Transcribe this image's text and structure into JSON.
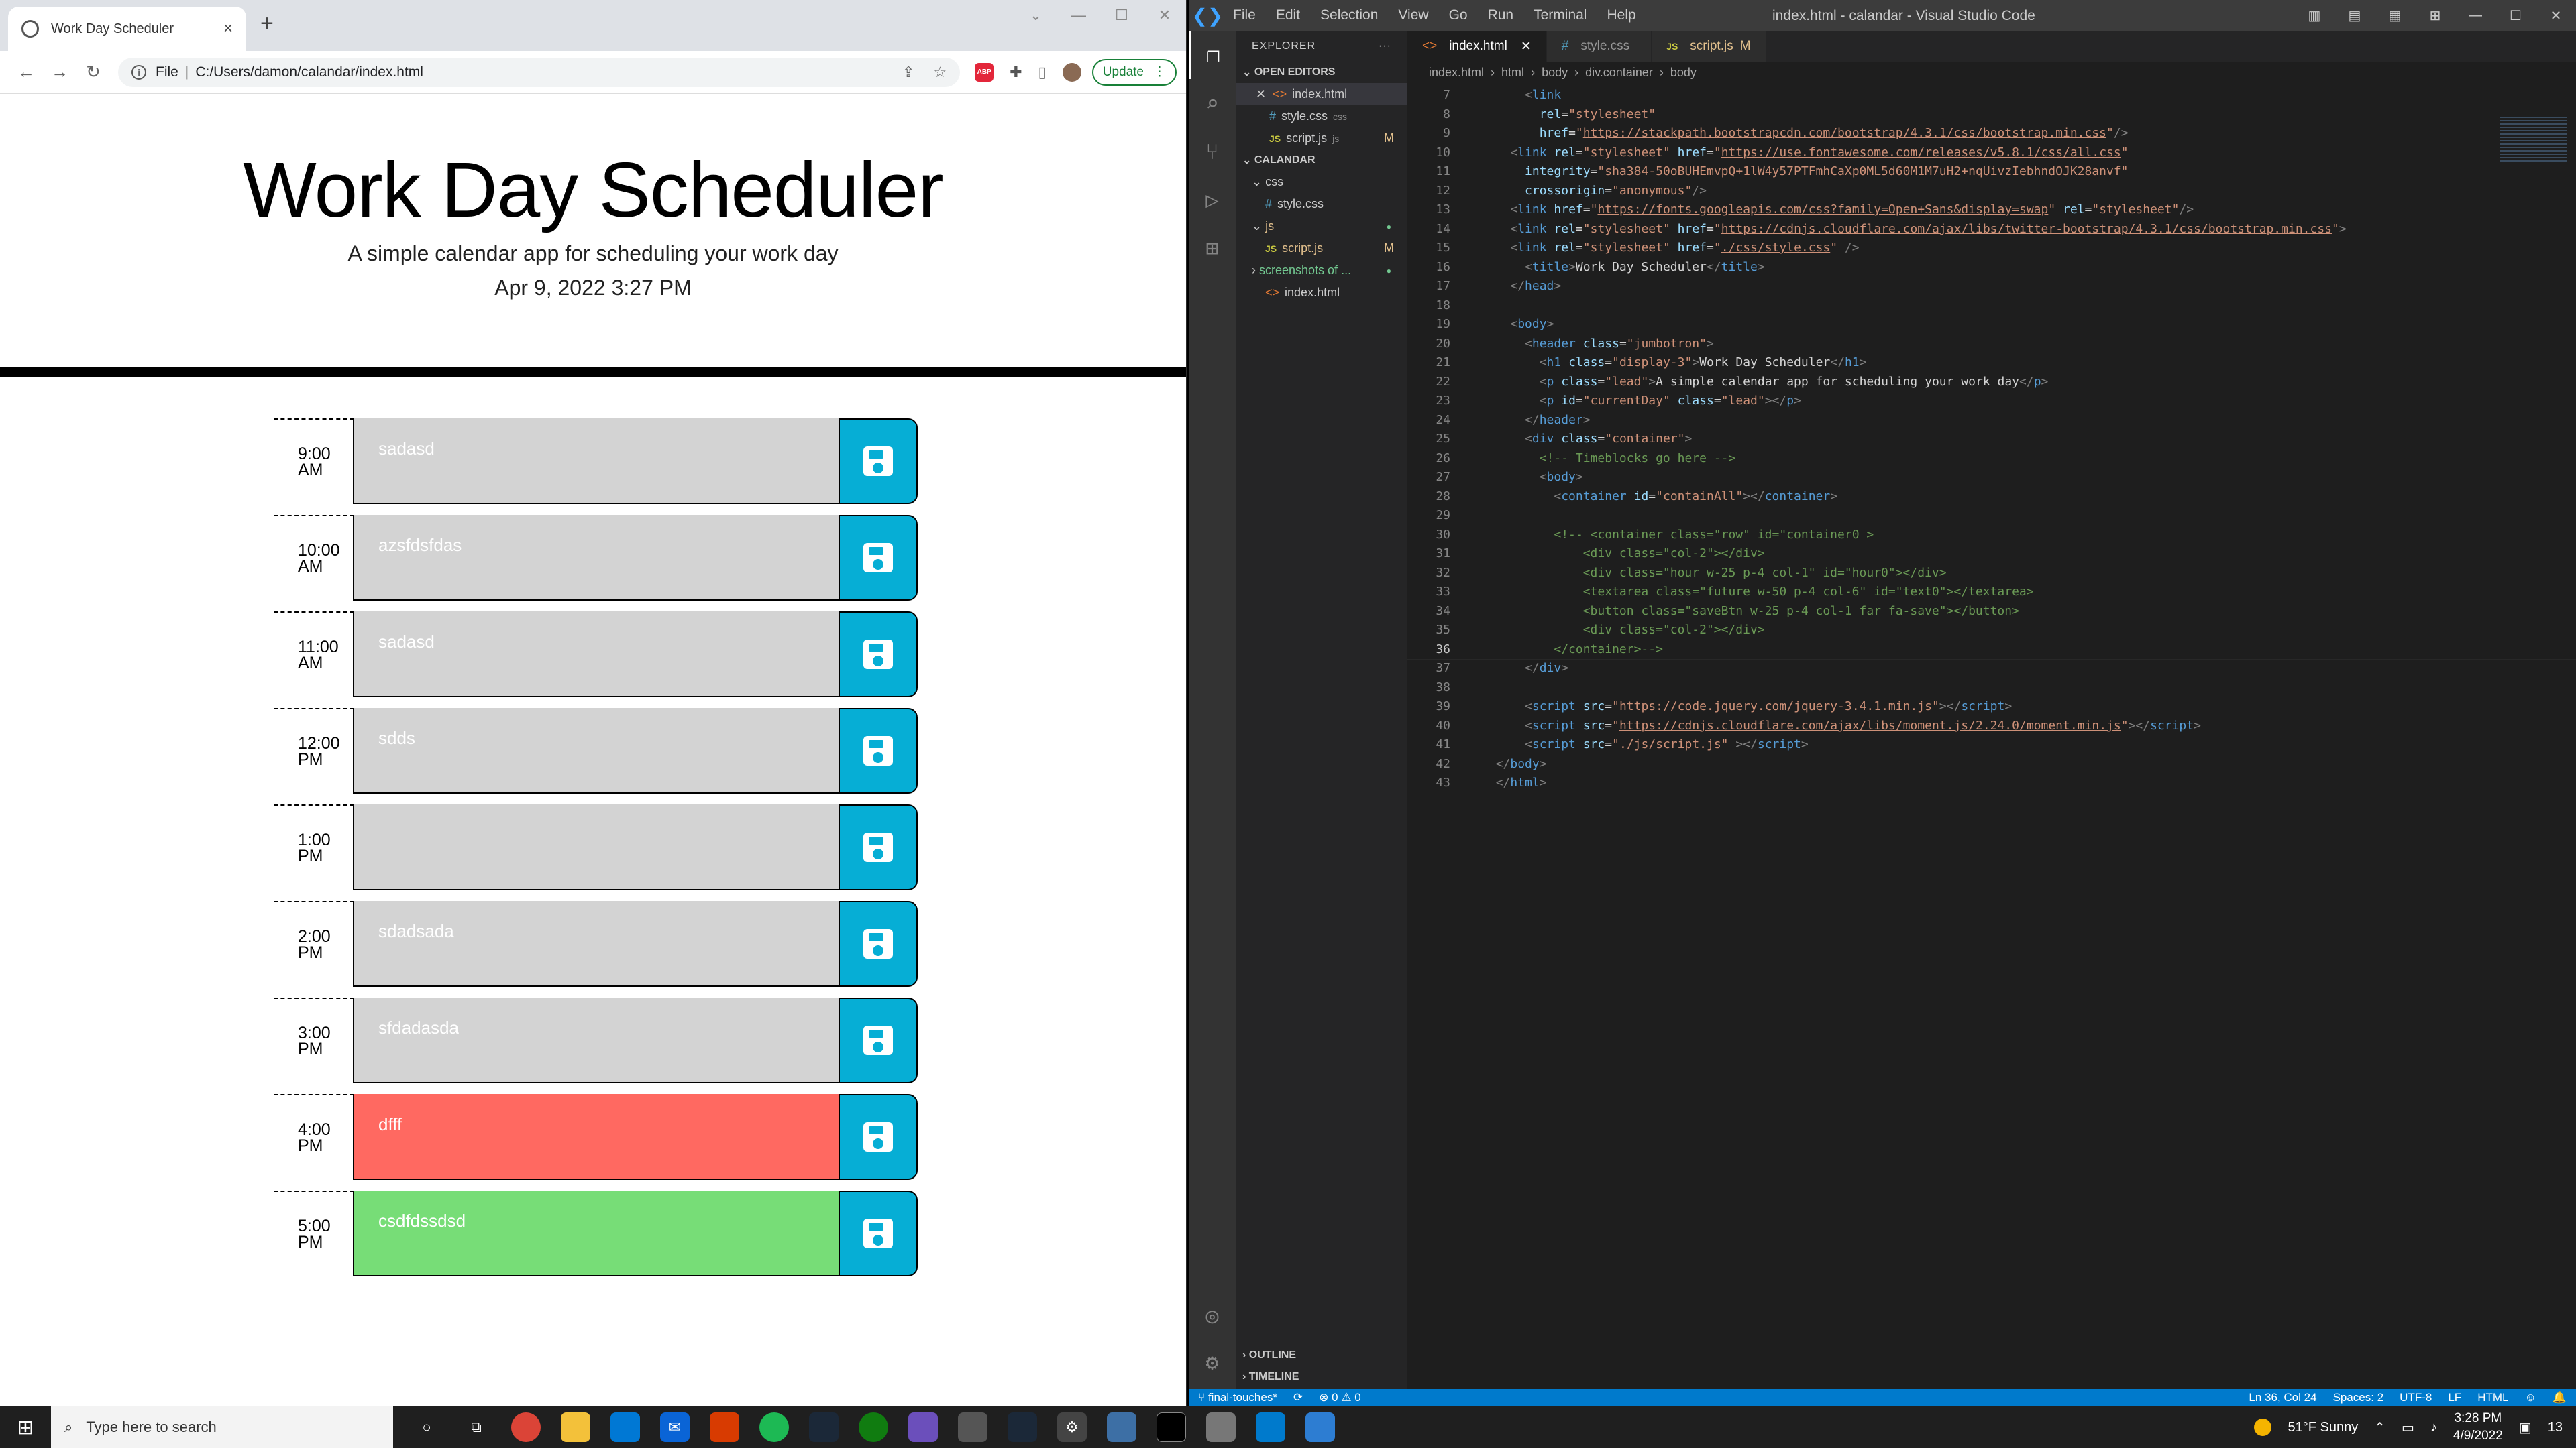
{
  "browser": {
    "tab_title": "Work Day Scheduler",
    "address_prefix": "File",
    "url": "C:/Users/damon/calandar/index.html",
    "update_label": "Update"
  },
  "scheduler": {
    "title": "Work Day Scheduler",
    "lead": "A simple calendar app for scheduling your work day",
    "current_day": "Apr 9, 2022 3:27 PM",
    "blocks": [
      {
        "hour": "9:00",
        "ampm": "AM",
        "text": "sadasd",
        "state": "past"
      },
      {
        "hour": "10:00",
        "ampm": "AM",
        "text": "azsfdsfdas",
        "state": "past"
      },
      {
        "hour": "11:00",
        "ampm": "AM",
        "text": "sadasd",
        "state": "past"
      },
      {
        "hour": "12:00",
        "ampm": "PM",
        "text": "sdds",
        "state": "past"
      },
      {
        "hour": "1:00",
        "ampm": "PM",
        "text": "",
        "state": "past"
      },
      {
        "hour": "2:00",
        "ampm": "PM",
        "text": "sdadsada",
        "state": "past"
      },
      {
        "hour": "3:00",
        "ampm": "PM",
        "text": "sfdadasda",
        "state": "past"
      },
      {
        "hour": "4:00",
        "ampm": "PM",
        "text": "dfff",
        "state": "present"
      },
      {
        "hour": "5:00",
        "ampm": "PM",
        "text": "csdfdssdsd",
        "state": "future"
      }
    ]
  },
  "vscode": {
    "window_title": "index.html - calandar - Visual Studio Code",
    "menu": [
      "File",
      "Edit",
      "Selection",
      "View",
      "Go",
      "Run",
      "Terminal",
      "Help"
    ],
    "explorer_title": "EXPLORER",
    "open_editors_label": "OPEN EDITORS",
    "open_editors": [
      {
        "name": "index.html",
        "hint": "",
        "badge": ""
      },
      {
        "name": "style.css",
        "hint": "css",
        "badge": ""
      },
      {
        "name": "script.js",
        "hint": "js",
        "badge": "M"
      }
    ],
    "project_label": "CALANDAR",
    "tree": [
      {
        "name": "css",
        "kind": "folder",
        "badge": ""
      },
      {
        "name": "style.css",
        "kind": "css",
        "badge": ""
      },
      {
        "name": "js",
        "kind": "folder",
        "badge": ""
      },
      {
        "name": "script.js",
        "kind": "js",
        "badge": "M"
      },
      {
        "name": "screenshots of ...",
        "kind": "folder",
        "badge": ""
      },
      {
        "name": "index.html",
        "kind": "html",
        "badge": ""
      }
    ],
    "outline_label": "OUTLINE",
    "timeline_label": "TIMELINE",
    "tabs": [
      {
        "name": "index.html",
        "modified": ""
      },
      {
        "name": "style.css",
        "modified": ""
      },
      {
        "name": "script.js",
        "modified": "M"
      }
    ],
    "breadcrumb": [
      "index.html",
      "html",
      "body",
      "div.container",
      "body"
    ],
    "code_lines": [
      {
        "n": "7",
        "html": "      <span class='t-tag'>&lt;</span><span class='t-nm'>link</span>"
      },
      {
        "n": "8",
        "html": "        <span class='t-at'>rel</span><span class='t-tx'>=</span><span class='t-st'>\"stylesheet\"</span>"
      },
      {
        "n": "9",
        "html": "        <span class='t-at'>href</span><span class='t-tx'>=</span><span class='t-st'>\"</span><span class='t-ln'>https://stackpath.bootstrapcdn.com/bootstrap/4.3.1/css/bootstrap.min.css</span><span class='t-st'>\"</span><span class='t-tag'>/&gt;</span>"
      },
      {
        "n": "10",
        "html": "    <span class='t-tag'>&lt;</span><span class='t-nm'>link</span> <span class='t-at'>rel</span><span class='t-tx'>=</span><span class='t-st'>\"stylesheet\"</span> <span class='t-at'>href</span><span class='t-tx'>=</span><span class='t-st'>\"</span><span class='t-ln'>https://use.fontawesome.com/releases/v5.8.1/css/all.css</span><span class='t-st'>\"</span>"
      },
      {
        "n": "11",
        "html": "      <span class='t-at'>integrity</span><span class='t-tx'>=</span><span class='t-st'>\"sha384-50oBUHEmvpQ+1lW4y57PTFmhCaXp0ML5d60M1M7uH2+nqUivzIebhndOJK28anvf\"</span>"
      },
      {
        "n": "12",
        "html": "      <span class='t-at'>crossorigin</span><span class='t-tx'>=</span><span class='t-st'>\"anonymous\"</span><span class='t-tag'>/&gt;</span>"
      },
      {
        "n": "13",
        "html": "    <span class='t-tag'>&lt;</span><span class='t-nm'>link</span> <span class='t-at'>href</span><span class='t-tx'>=</span><span class='t-st'>\"</span><span class='t-ln'>https://fonts.googleapis.com/css?family=Open+Sans&amp;display=swap</span><span class='t-st'>\"</span> <span class='t-at'>rel</span><span class='t-tx'>=</span><span class='t-st'>\"stylesheet\"</span><span class='t-tag'>/&gt;</span>"
      },
      {
        "n": "14",
        "html": "    <span class='t-tag'>&lt;</span><span class='t-nm'>link</span> <span class='t-at'>rel</span><span class='t-tx'>=</span><span class='t-st'>\"stylesheet\"</span> <span class='t-at'>href</span><span class='t-tx'>=</span><span class='t-st'>\"</span><span class='t-ln'>https://cdnjs.cloudflare.com/ajax/libs/twitter-bootstrap/4.3.1/css/bootstrap.min.css</span><span class='t-st'>\"</span><span class='t-tag'>&gt;</span>"
      },
      {
        "n": "15",
        "html": "    <span class='t-tag'>&lt;</span><span class='t-nm'>link</span> <span class='t-at'>rel</span><span class='t-tx'>=</span><span class='t-st'>\"stylesheet\"</span> <span class='t-at'>href</span><span class='t-tx'>=</span><span class='t-st'>\"</span><span class='t-ln'>./css/style.css</span><span class='t-st'>\"</span> <span class='t-tag'>/&gt;</span>"
      },
      {
        "n": "16",
        "html": "      <span class='t-tag'>&lt;</span><span class='t-nm'>title</span><span class='t-tag'>&gt;</span><span class='t-tx'>Work Day Scheduler</span><span class='t-tag'>&lt;/</span><span class='t-nm'>title</span><span class='t-tag'>&gt;</span>"
      },
      {
        "n": "17",
        "html": "    <span class='t-tag'>&lt;/</span><span class='t-nm'>head</span><span class='t-tag'>&gt;</span>"
      },
      {
        "n": "18",
        "html": ""
      },
      {
        "n": "19",
        "html": "    <span class='t-tag'>&lt;</span><span class='t-nm'>body</span><span class='t-tag'>&gt;</span>"
      },
      {
        "n": "20",
        "html": "      <span class='t-tag'>&lt;</span><span class='t-nm'>header</span> <span class='t-at'>class</span><span class='t-tx'>=</span><span class='t-st'>\"jumbotron\"</span><span class='t-tag'>&gt;</span>"
      },
      {
        "n": "21",
        "html": "        <span class='t-tag'>&lt;</span><span class='t-nm'>h1</span> <span class='t-at'>class</span><span class='t-tx'>=</span><span class='t-st'>\"display-3\"</span><span class='t-tag'>&gt;</span><span class='t-tx'>Work Day Scheduler</span><span class='t-tag'>&lt;/</span><span class='t-nm'>h1</span><span class='t-tag'>&gt;</span>"
      },
      {
        "n": "22",
        "html": "        <span class='t-tag'>&lt;</span><span class='t-nm'>p</span> <span class='t-at'>class</span><span class='t-tx'>=</span><span class='t-st'>\"lead\"</span><span class='t-tag'>&gt;</span><span class='t-tx'>A simple calendar app for scheduling your work day</span><span class='t-tag'>&lt;/</span><span class='t-nm'>p</span><span class='t-tag'>&gt;</span>"
      },
      {
        "n": "23",
        "html": "        <span class='t-tag'>&lt;</span><span class='t-nm'>p</span> <span class='t-at'>id</span><span class='t-tx'>=</span><span class='t-st'>\"currentDay\"</span> <span class='t-at'>class</span><span class='t-tx'>=</span><span class='t-st'>\"lead\"</span><span class='t-tag'>&gt;&lt;/</span><span class='t-nm'>p</span><span class='t-tag'>&gt;</span>"
      },
      {
        "n": "24",
        "html": "      <span class='t-tag'>&lt;/</span><span class='t-nm'>header</span><span class='t-tag'>&gt;</span>"
      },
      {
        "n": "25",
        "html": "      <span class='t-tag'>&lt;</span><span class='t-nm'>div</span> <span class='t-at'>class</span><span class='t-tx'>=</span><span class='t-st'>\"container\"</span><span class='t-tag'>&gt;</span>"
      },
      {
        "n": "26",
        "html": "        <span class='t-cm'>&lt;!-- Timeblocks go here --&gt;</span>"
      },
      {
        "n": "27",
        "html": "        <span class='t-tag'>&lt;</span><span class='t-nm'>body</span><span class='t-tag'>&gt;</span>"
      },
      {
        "n": "28",
        "html": "          <span class='t-tag'>&lt;</span><span class='t-nm'>container</span> <span class='t-at'>id</span><span class='t-tx'>=</span><span class='t-st'>\"containAll\"</span><span class='t-tag'>&gt;&lt;/</span><span class='t-nm'>container</span><span class='t-tag'>&gt;</span>"
      },
      {
        "n": "29",
        "html": ""
      },
      {
        "n": "30",
        "html": "          <span class='t-cm'>&lt;!-- &lt;container class=\"row\" id=\"container0 &gt;</span>"
      },
      {
        "n": "31",
        "html": "              <span class='t-cm'>&lt;div class=\"col-2\"&gt;&lt;/div&gt;</span>"
      },
      {
        "n": "32",
        "html": "              <span class='t-cm'>&lt;div class=\"hour w-25 p-4 col-1\" id=\"hour0\"&gt;&lt;/div&gt;</span>"
      },
      {
        "n": "33",
        "html": "              <span class='t-cm'>&lt;textarea class=\"future w-50 p-4 col-6\" id=\"text0\"&gt;&lt;/textarea&gt;</span>"
      },
      {
        "n": "34",
        "html": "              <span class='t-cm'>&lt;button class=\"saveBtn w-25 p-4 col-1 far fa-save\"&gt;&lt;/button&gt;</span>"
      },
      {
        "n": "35",
        "html": "              <span class='t-cm'>&lt;div class=\"col-2\"&gt;&lt;/div&gt;</span>"
      },
      {
        "n": "36",
        "html": "          <span class='t-cm'>&lt;/container&gt;--&gt;</span>"
      },
      {
        "n": "37",
        "html": "      <span class='t-tag'>&lt;/</span><span class='t-nm'>div</span><span class='t-tag'>&gt;</span>"
      },
      {
        "n": "38",
        "html": ""
      },
      {
        "n": "39",
        "html": "      <span class='t-tag'>&lt;</span><span class='t-nm'>script</span> <span class='t-at'>src</span><span class='t-tx'>=</span><span class='t-st'>\"</span><span class='t-ln'>https://code.jquery.com/jquery-3.4.1.min.js</span><span class='t-st'>\"</span><span class='t-tag'>&gt;&lt;/</span><span class='t-nm'>script</span><span class='t-tag'>&gt;</span>"
      },
      {
        "n": "40",
        "html": "      <span class='t-tag'>&lt;</span><span class='t-nm'>script</span> <span class='t-at'>src</span><span class='t-tx'>=</span><span class='t-st'>\"</span><span class='t-ln'>https://cdnjs.cloudflare.com/ajax/libs/moment.js/2.24.0/moment.min.js</span><span class='t-st'>\"</span><span class='t-tag'>&gt;&lt;/</span><span class='t-nm'>script</span><span class='t-tag'>&gt;</span>"
      },
      {
        "n": "41",
        "html": "      <span class='t-tag'>&lt;</span><span class='t-nm'>script</span> <span class='t-at'>src</span><span class='t-tx'>=</span><span class='t-st'>\"</span><span class='t-ln'>./js/script.js</span><span class='t-st'>\"</span> <span class='t-tag'>&gt;&lt;/</span><span class='t-nm'>script</span><span class='t-tag'>&gt;</span>"
      },
      {
        "n": "42",
        "html": "  <span class='t-tag'>&lt;/</span><span class='t-nm'>body</span><span class='t-tag'>&gt;</span>"
      },
      {
        "n": "43",
        "html": "  <span class='t-tag'>&lt;/</span><span class='t-nm'>html</span><span class='t-tag'>&gt;</span>"
      }
    ],
    "current_line": "36",
    "status": {
      "branch": "final-touches*",
      "problems": "⊗ 0 ⚠ 0",
      "cursor": "Ln 36, Col 24",
      "spaces": "Spaces: 2",
      "encoding": "UTF-8",
      "eol": "LF",
      "language": "HTML"
    }
  },
  "taskbar": {
    "search_placeholder": "Type here to search",
    "weather": "51°F  Sunny",
    "time": "3:28 PM",
    "date": "4/9/2022",
    "notifications": "13"
  },
  "colors": {
    "past": "#d3d3d3",
    "present": "#ff6961",
    "future": "#77dd77",
    "save_button": "#06aed5",
    "statusbar": "#007acc"
  }
}
